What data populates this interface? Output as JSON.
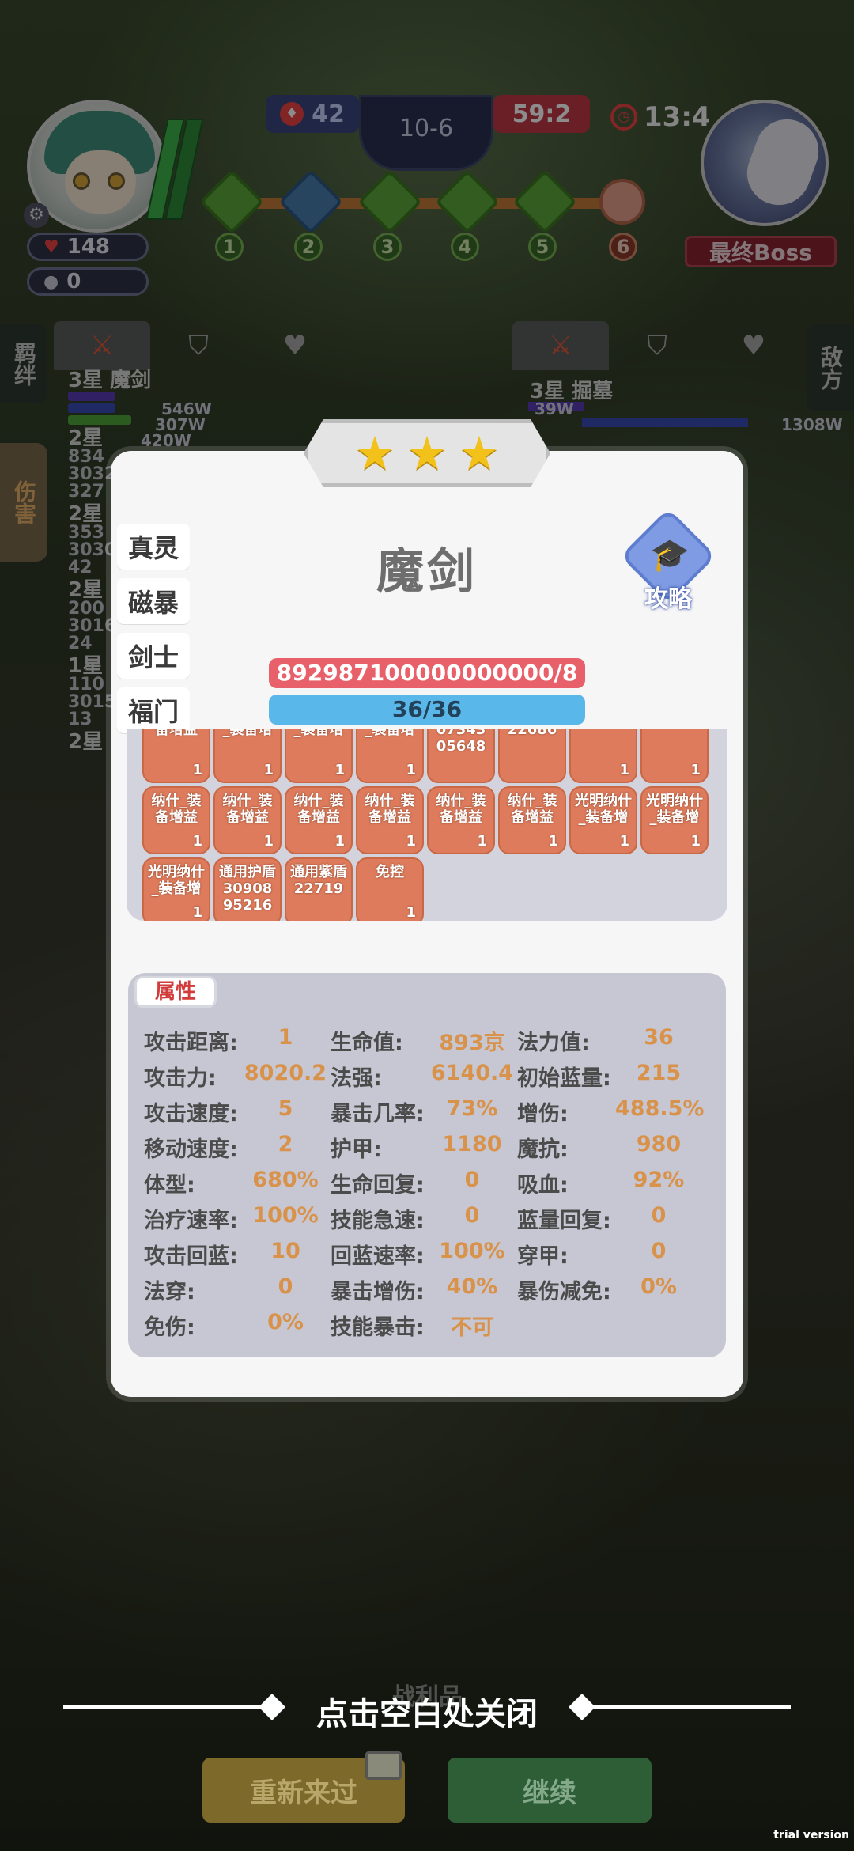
{
  "hud": {
    "player_hp": "148",
    "player_coins": "0",
    "enemy_score": "42",
    "level": "10-6",
    "my_score": "59:2",
    "timer": "13:4",
    "boss_label": "最终Boss",
    "stages": [
      "1",
      "2",
      "3",
      "4",
      "5",
      "6"
    ]
  },
  "background_panel": {
    "left_tab_1": "羁绊",
    "left_tab_2": "伤害",
    "right_tab": "敌方",
    "left_unit_header": "3星 魔剑",
    "right_unit_header": "3星 掘墓",
    "bars": [
      "546W",
      "307W",
      "420W",
      "39W",
      "1308W"
    ],
    "rows": [
      {
        "hd": "2星",
        "nums": [
          "834",
          "3032",
          "327"
        ]
      },
      {
        "hd": "2星",
        "nums": [
          "353",
          "3030",
          "42"
        ]
      },
      {
        "hd": "2星",
        "nums": [
          "200",
          "3016",
          "24"
        ]
      },
      {
        "hd": "1星",
        "nums": [
          "110",
          "3015",
          "13"
        ]
      },
      {
        "hd": "2星",
        "nums": []
      }
    ]
  },
  "popup": {
    "stars": 3,
    "unit_name": "魔剑",
    "guide_label": "攻略",
    "side_tabs": [
      "真灵",
      "磁暴",
      "剑士",
      "福门"
    ],
    "exp_text": "892987100000000000/8",
    "level_text": "36/36",
    "equipment": [
      {
        "name": "备增益",
        "count": "1"
      },
      {
        "name": "_装备增",
        "count": "1"
      },
      {
        "name": "_装备增",
        "count": "1"
      },
      {
        "name": "_装备增",
        "count": "1"
      },
      {
        "name": "07343\n05648",
        "count": ""
      },
      {
        "name": "22686",
        "count": ""
      },
      {
        "name": "",
        "count": "1"
      },
      {
        "name": "",
        "count": "1"
      },
      {
        "name": "纳什_装\n备增益",
        "count": "1"
      },
      {
        "name": "纳什_装\n备增益",
        "count": "1"
      },
      {
        "name": "纳什_装\n备增益",
        "count": "1"
      },
      {
        "name": "纳什_装\n备增益",
        "count": "1"
      },
      {
        "name": "纳什_装\n备增益",
        "count": "1"
      },
      {
        "name": "纳什_装\n备增益",
        "count": "1"
      },
      {
        "name": "光明纳什\n_装备增",
        "count": "1"
      },
      {
        "name": "光明纳什\n_装备增",
        "count": "1"
      },
      {
        "name": "光明纳什\n_装备增",
        "count": "1"
      },
      {
        "name": "通用护盾\n30908\n95216",
        "count": ""
      },
      {
        "name": "通用紫盾\n22719",
        "count": ""
      },
      {
        "name": "免控",
        "count": "1"
      }
    ],
    "attr_tag": "属性",
    "attributes": [
      [
        {
          "k": "攻击距离:",
          "v": "1"
        },
        {
          "k": "生命值:",
          "v": "893京"
        },
        {
          "k": "法力值:",
          "v": "36"
        }
      ],
      [
        {
          "k": "攻击力:",
          "v": "8020.2"
        },
        {
          "k": "法强:",
          "v": "6140.4"
        },
        {
          "k": "初始蓝量:",
          "v": "215"
        }
      ],
      [
        {
          "k": "攻击速度:",
          "v": "5"
        },
        {
          "k": "暴击几率:",
          "v": "73%"
        },
        {
          "k": "增伤:",
          "v": "488.5%"
        }
      ],
      [
        {
          "k": "移动速度:",
          "v": "2"
        },
        {
          "k": "护甲:",
          "v": "1180"
        },
        {
          "k": "魔抗:",
          "v": "980"
        }
      ],
      [
        {
          "k": "体型:",
          "v": "680%"
        },
        {
          "k": "生命回复:",
          "v": "0"
        },
        {
          "k": "吸血:",
          "v": "92%"
        }
      ],
      [
        {
          "k": "治疗速率:",
          "v": "100%"
        },
        {
          "k": "技能急速:",
          "v": "0"
        },
        {
          "k": "蓝量回复:",
          "v": "0"
        }
      ],
      [
        {
          "k": "攻击回蓝:",
          "v": "10"
        },
        {
          "k": "回蓝速率:",
          "v": "100%"
        },
        {
          "k": "穿甲:",
          "v": "0"
        }
      ],
      [
        {
          "k": "法穿:",
          "v": "0"
        },
        {
          "k": "暴击增伤:",
          "v": "40%"
        },
        {
          "k": "暴伤减免:",
          "v": "0%"
        }
      ],
      [
        {
          "k": "免伤:",
          "v": "0%"
        },
        {
          "k": "技能暴击:",
          "v": "不可"
        }
      ]
    ]
  },
  "footer": {
    "loot_label": "战利品",
    "close_hint": "点击空白处关闭",
    "retry_label": "重新来过",
    "continue_label": "继续",
    "trial": "trial version"
  },
  "colors": {
    "accent_red": "#e8616a",
    "accent_blue": "#5ab7ea",
    "equip_orange": "#dd7b5c",
    "attr_value": "#d9924a"
  }
}
